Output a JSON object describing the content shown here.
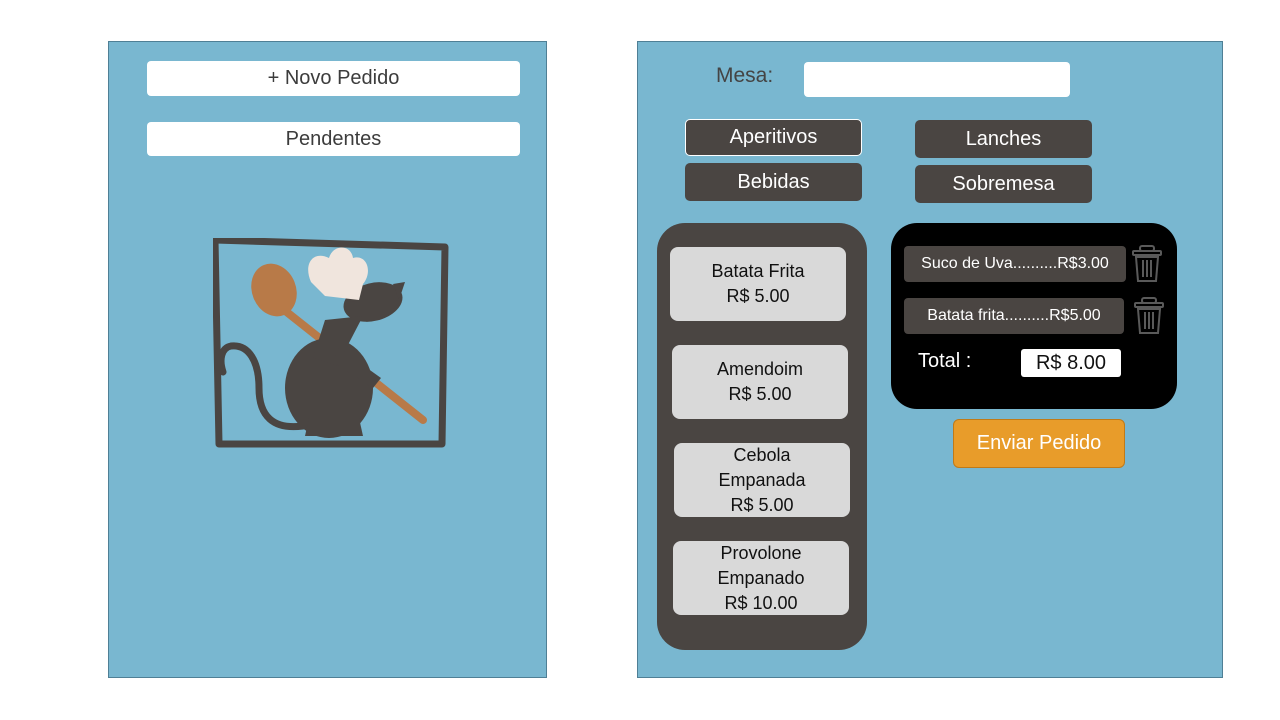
{
  "left_panel": {
    "new_order_label": "+ Novo Pedido",
    "pending_label": "Pendentes"
  },
  "right_panel": {
    "table_label": "Mesa:",
    "table_value": "",
    "categories": {
      "appetizers": "Aperitivos",
      "snacks": "Lanches",
      "drinks": "Bebidas",
      "desserts": "Sobremesa"
    },
    "menu_items": [
      {
        "name": "Batata Frita",
        "price": "R$ 5.00"
      },
      {
        "name": "Amendoim",
        "price": "R$ 5.00"
      },
      {
        "name_line1": "Cebola",
        "name_line2": "Empanada",
        "price": "R$ 5.00"
      },
      {
        "name_line1": "Provolone",
        "name_line2": "Empanado",
        "price": "R$ 10.00"
      }
    ],
    "order_items": [
      {
        "label": "Suco de Uva..........R$3.00"
      },
      {
        "label": "Batata frita..........R$5.00"
      }
    ],
    "total_label": "Total :",
    "total_value": "R$ 8.00",
    "send_label": "Enviar Pedido"
  },
  "colors": {
    "panel_bg": "#79b7d0",
    "dark_button": "#4a4542",
    "order_box": "#000000",
    "send_button": "#e89c2a",
    "menu_item_bg": "#d9d9d9"
  },
  "icons": {
    "logo": "chef-rat-logo",
    "trash": "trash-icon"
  }
}
